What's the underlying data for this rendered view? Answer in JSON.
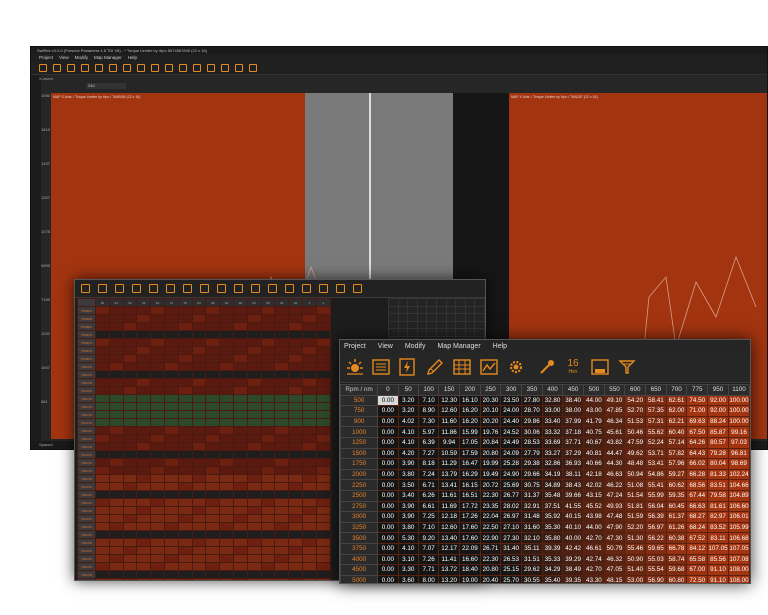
{
  "bg_window": {
    "title": "SwiRes v3.0.0 (Porsche Panamera 4.8 TDI V8) - * Torque Limiter by rbpo 5674567849 (22 x 16)",
    "menu": [
      "Project",
      "View",
      "Modify",
      "Map Manager",
      "Help"
    ],
    "plot_left_header": "MAP  X Axis: / Torque Limiter by Hpu / 76AB/54 (22 x 16)",
    "plot_right_header": "MAP  X Axis: / Torque Limiter by Hpu / 76AD57 (22 x 16)",
    "y_labels": [
      "1940",
      "1619",
      "1437",
      "1257",
      "1078",
      "0895",
      "7199",
      "1292",
      "1007",
      "861"
    ],
    "status": "Spaced",
    "zoom_label": "X-zoom",
    "zoom_value": "240"
  },
  "mid_window": {
    "col_headers": [
      "26",
      "44",
      "52",
      "56",
      "62",
      "72",
      "78",
      "84",
      "88",
      "94",
      "96",
      "54",
      "58",
      "64",
      "62",
      "1",
      "4"
    ],
    "row_headers": [
      "76ABD4",
      "76ABD8",
      "76ABDC",
      "76ABC0",
      "76ABC4",
      "76ABC8",
      "76ABCC",
      "76AC00",
      "76AC04",
      "76AC08",
      "76AC0C",
      "76AC10",
      "76AC14",
      "76AC18",
      "76AC1C",
      "76AC20",
      "76AC24",
      "76AC28",
      "76AC2C",
      "76AC30",
      "76AC34",
      "76AC38",
      "76AC3C",
      "76AC40",
      "76AC44",
      "76AC48",
      "76AC4C",
      "76AC50",
      "76AC54",
      "76AC58",
      "76AC5C",
      "76AC60",
      "76AC64",
      "76AC68",
      "76AC6C"
    ]
  },
  "main_window": {
    "menu": [
      {
        "label": "Project"
      },
      {
        "label": "View"
      },
      {
        "label": "Modify"
      },
      {
        "label": "Map Manager"
      },
      {
        "label": "Help"
      }
    ],
    "toolbar_icons": [
      "brightness-icon",
      "table-icon",
      "flash-icon",
      "edit-icon",
      "grid-icon",
      "chart-icon",
      "gear-icon",
      "pipette-icon",
      "hex-icon",
      "binary-icon",
      "filter-icon"
    ],
    "hex_label_top": "16",
    "hex_label_bottom": "Hex",
    "bin_label": "BIN",
    "corner_label": "Rpm / nm",
    "columns": [
      "0",
      "50",
      "100",
      "150",
      "200",
      "250",
      "300",
      "350",
      "400",
      "450",
      "500",
      "550",
      "600",
      "650",
      "700",
      "775",
      "950",
      "1100"
    ],
    "rows": [
      {
        "rpm": "500",
        "vals": [
          "0.00",
          "3.20",
          "7.10",
          "12.30",
          "16.10",
          "20.30",
          "23.50",
          "27.80",
          "32.80",
          "38.40",
          "44.00",
          "49.10",
          "54.20",
          "58.41",
          "62.61",
          "74.50",
          "92.00",
          "100.00"
        ]
      },
      {
        "rpm": "750",
        "vals": [
          "0.00",
          "3.20",
          "8.90",
          "12.60",
          "16.20",
          "20.10",
          "24.00",
          "28.70",
          "33.00",
          "38.00",
          "43.00",
          "47.85",
          "52.70",
          "57.35",
          "62.00",
          "71.00",
          "92.00",
          "100.00"
        ]
      },
      {
        "rpm": "900",
        "vals": [
          "0.00",
          "4.02",
          "7.30",
          "11.60",
          "16.20",
          "20.20",
          "24.40",
          "29.86",
          "33.40",
          "37.99",
          "41.79",
          "46.34",
          "51.53",
          "57.31",
          "62.21",
          "69.63",
          "88.24",
          "100.00"
        ]
      },
      {
        "rpm": "1000",
        "vals": [
          "0.00",
          "4.10",
          "5.97",
          "11.86",
          "15.99",
          "19.76",
          "24.52",
          "30.06",
          "33.32",
          "37.18",
          "40.75",
          "45.61",
          "50.46",
          "55.62",
          "60.40",
          "67.50",
          "85.87",
          "99.16"
        ]
      },
      {
        "rpm": "1250",
        "vals": [
          "0.00",
          "4.10",
          "6.39",
          "9.94",
          "17.05",
          "20.84",
          "24.49",
          "28.53",
          "33.69",
          "37.71",
          "40.67",
          "43.82",
          "47.59",
          "52.24",
          "57.14",
          "64.26",
          "80.57",
          "97.03"
        ]
      },
      {
        "rpm": "1500",
        "vals": [
          "0.00",
          "4.20",
          "7.27",
          "10.59",
          "17.59",
          "20.80",
          "24.09",
          "27.79",
          "33.27",
          "37.29",
          "40.81",
          "44.47",
          "49.62",
          "53.71",
          "57.82",
          "64.43",
          "79.28",
          "96.81"
        ]
      },
      {
        "rpm": "1750",
        "vals": [
          "0.00",
          "3.90",
          "8.18",
          "11.29",
          "16.47",
          "19.99",
          "25.28",
          "29.38",
          "32.86",
          "36.93",
          "40.66",
          "44.30",
          "48.48",
          "53.41",
          "57.96",
          "66.02",
          "80.04",
          "98.69"
        ]
      },
      {
        "rpm": "2000",
        "vals": [
          "0.00",
          "3.80",
          "7.24",
          "13.79",
          "16.29",
          "19.49",
          "24.90",
          "29.66",
          "34.19",
          "38.11",
          "42.18",
          "46.63",
          "50.94",
          "54.86",
          "59.27",
          "66.28",
          "81.33",
          "102.24"
        ]
      },
      {
        "rpm": "2250",
        "vals": [
          "0.00",
          "3.50",
          "6.71",
          "13.41",
          "16.15",
          "20.72",
          "25.69",
          "30.75",
          "34.89",
          "38.43",
          "42.02",
          "46.22",
          "51.08",
          "55.41",
          "60.62",
          "68.56",
          "83.51",
          "104.66"
        ]
      },
      {
        "rpm": "2500",
        "vals": [
          "0.00",
          "3.40",
          "6.26",
          "11.61",
          "16.51",
          "22.30",
          "26.77",
          "31.37",
          "35.48",
          "39.66",
          "43.15",
          "47.24",
          "51.54",
          "55.99",
          "59.35",
          "67.44",
          "79.58",
          "104.89"
        ]
      },
      {
        "rpm": "2750",
        "vals": [
          "0.00",
          "3.90",
          "6.61",
          "11.69",
          "17.72",
          "23.35",
          "28.02",
          "32.91",
          "37.51",
          "41.55",
          "45.52",
          "49.93",
          "51.81",
          "56.04",
          "60.45",
          "66.63",
          "81.61",
          "106.60"
        ]
      },
      {
        "rpm": "3000",
        "vals": [
          "0.00",
          "3.90",
          "7.25",
          "12.18",
          "17.26",
          "22.04",
          "26.97",
          "31.48",
          "35.92",
          "40.15",
          "43.98",
          "47.48",
          "51.59",
          "56.39",
          "61.37",
          "68.27",
          "82.97",
          "106.01"
        ]
      },
      {
        "rpm": "3250",
        "vals": [
          "0.00",
          "3.80",
          "7.10",
          "12.60",
          "17.60",
          "22.50",
          "27.10",
          "31.60",
          "35.30",
          "40.10",
          "44.00",
          "47.90",
          "52.20",
          "56.97",
          "61.26",
          "68.24",
          "83.52",
          "105.99"
        ]
      },
      {
        "rpm": "3500",
        "vals": [
          "0.00",
          "5.30",
          "9.20",
          "13.40",
          "17.60",
          "22.90",
          "27.30",
          "32.10",
          "35.80",
          "40.00",
          "42.70",
          "47.30",
          "51.30",
          "56.22",
          "60.38",
          "67.52",
          "83.11",
          "106.68"
        ]
      },
      {
        "rpm": "3750",
        "vals": [
          "0.00",
          "4.10",
          "7.07",
          "12.17",
          "22.09",
          "26.71",
          "31.40",
          "35.11",
          "39.39",
          "42.42",
          "46.61",
          "50.79",
          "55.46",
          "59.65",
          "66.78",
          "84.12",
          "107.05",
          "107.05"
        ]
      },
      {
        "rpm": "4000",
        "vals": [
          "0.00",
          "3.10",
          "7.26",
          "11.41",
          "16.60",
          "22.30",
          "26.53",
          "31.51",
          "35.33",
          "39.29",
          "42.74",
          "46.32",
          "50.90",
          "55.03",
          "58.74",
          "65.58",
          "85.56",
          "107.08"
        ]
      },
      {
        "rpm": "4500",
        "vals": [
          "0.00",
          "3.30",
          "7.71",
          "13.72",
          "18.40",
          "20.80",
          "25.15",
          "29.62",
          "34.29",
          "38.49",
          "42.70",
          "47.05",
          "51.40",
          "55.54",
          "59.68",
          "67.00",
          "91.10",
          "108.00"
        ]
      },
      {
        "rpm": "5000",
        "vals": [
          "0.00",
          "3.60",
          "8.00",
          "13.20",
          "19.00",
          "20.40",
          "25.70",
          "30.55",
          "35.40",
          "39.35",
          "43.30",
          "48.15",
          "53.00",
          "56.90",
          "60.80",
          "72.50",
          "91.10",
          "108.00"
        ]
      }
    ],
    "colors": {
      "low": "#151515",
      "high": "#a33410",
      "selected": "#d9d9d9"
    }
  }
}
